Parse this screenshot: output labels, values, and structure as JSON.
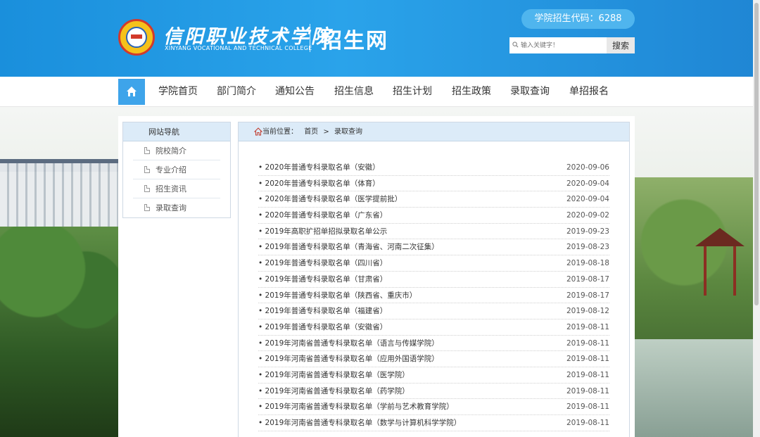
{
  "header": {
    "school_name": "信阳职业技术学院",
    "school_name_en": "XINYANG VOCATIONAL AND TECHNICAL COLLEGE",
    "site_name": "招生网",
    "admission_code": "学院招生代码：6288",
    "search_placeholder": "输入关键字！",
    "search_button": "搜索"
  },
  "nav": {
    "items": [
      "学院首页",
      "部门简介",
      "通知公告",
      "招生信息",
      "招生计划",
      "招生政策",
      "录取查询",
      "单招报名"
    ]
  },
  "sidebar": {
    "title": "网站导航",
    "items": [
      "院校简介",
      "专业介绍",
      "招生资讯",
      "录取查询"
    ]
  },
  "breadcrumb": {
    "label": "当前位置：",
    "home": "首页",
    "sep": ">",
    "current": "录取查询"
  },
  "list": [
    {
      "title": "2020年普通专科录取名单（安徽）",
      "date": "2020-09-06"
    },
    {
      "title": "2020年普通专科录取名单（体育）",
      "date": "2020-09-04"
    },
    {
      "title": "2020年普通专科录取名单（医学提前批）",
      "date": "2020-09-04"
    },
    {
      "title": "2020年普通专科录取名单（广东省）",
      "date": "2020-09-02"
    },
    {
      "title": "2019年高职扩招单招拟录取名单公示",
      "date": "2019-09-23"
    },
    {
      "title": "2019年普通专科录取名单（青海省、河南二次征集）",
      "date": "2019-08-23"
    },
    {
      "title": "2019年普通专科录取名单（四川省）",
      "date": "2019-08-18"
    },
    {
      "title": "2019年普通专科录取名单（甘肃省）",
      "date": "2019-08-17"
    },
    {
      "title": "2019年普通专科录取名单（陕西省、重庆市）",
      "date": "2019-08-17"
    },
    {
      "title": "2019年普通专科录取名单（福建省）",
      "date": "2019-08-12"
    },
    {
      "title": "2019年普通专科录取名单（安徽省）",
      "date": "2019-08-11"
    },
    {
      "title": "2019年河南省普通专科录取名单（语言与传媒学院）",
      "date": "2019-08-11"
    },
    {
      "title": "2019年河南省普通专科录取名单（应用外国语学院）",
      "date": "2019-08-11"
    },
    {
      "title": "2019年河南省普通专科录取名单（医学院）",
      "date": "2019-08-11"
    },
    {
      "title": "2019年河南省普通专科录取名单（药学院）",
      "date": "2019-08-11"
    },
    {
      "title": "2019年河南省普通专科录取名单（学前与艺术教育学院）",
      "date": "2019-08-11"
    },
    {
      "title": "2019年河南省普通专科录取名单（数学与计算机科学学院）",
      "date": "2019-08-11"
    }
  ],
  "colors": {
    "header_blue": "#1a8fdc",
    "nav_home_blue": "#3ea4ea",
    "panel_header": "#dcebf8"
  }
}
